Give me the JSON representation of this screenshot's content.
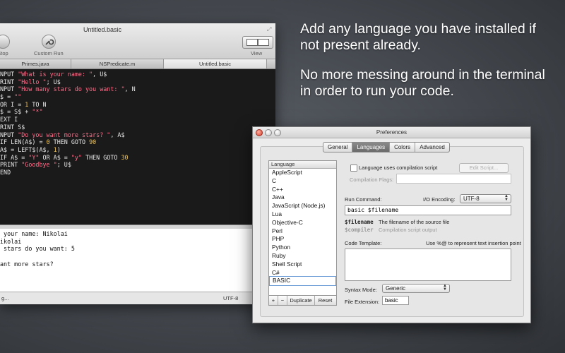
{
  "editor": {
    "title": "Untitled.basic",
    "toolbar": {
      "stop_label": "Stop",
      "custom_run_label": "Custom Run",
      "view_label": "View"
    },
    "tabs": [
      {
        "label": "Primes.java"
      },
      {
        "label": "NSPredicate.m"
      },
      {
        "label": "Untitled.basic"
      }
    ],
    "code_lines": [
      [
        {
          "t": "NPUT ",
          "c": "kw"
        },
        {
          "t": "\"What is your name: \"",
          "c": "str"
        },
        {
          "t": ", U$",
          "c": "var"
        }
      ],
      [
        {
          "t": "RINT ",
          "c": "kw"
        },
        {
          "t": "\"Hello \"",
          "c": "str"
        },
        {
          "t": "; U$",
          "c": "var"
        }
      ],
      [
        {
          "t": "NPUT ",
          "c": "kw"
        },
        {
          "t": "\"How many stars do you want: \"",
          "c": "str"
        },
        {
          "t": ", N",
          "c": "var"
        }
      ],
      [
        {
          "t": "$ = ",
          "c": "var"
        },
        {
          "t": "\"\"",
          "c": "str"
        }
      ],
      [
        {
          "t": "OR I = ",
          "c": "kw"
        },
        {
          "t": "1",
          "c": "num"
        },
        {
          "t": " TO N",
          "c": "kw"
        }
      ],
      [
        {
          "t": "$ = S$ + ",
          "c": "var"
        },
        {
          "t": "\"*\"",
          "c": "str"
        }
      ],
      [
        {
          "t": "EXT I",
          "c": "kw"
        }
      ],
      [
        {
          "t": "RINT S$",
          "c": "kw"
        }
      ],
      [
        {
          "t": "NPUT ",
          "c": "kw"
        },
        {
          "t": "\"Do you want more stars? \"",
          "c": "str"
        },
        {
          "t": ", A$",
          "c": "var"
        }
      ],
      [
        {
          "t": "IF LEN(A$) = ",
          "c": "kw"
        },
        {
          "t": "0",
          "c": "num"
        },
        {
          "t": " THEN GOTO ",
          "c": "kw"
        },
        {
          "t": "90",
          "c": "num"
        }
      ],
      [
        {
          "t": "A$ = LEFT$(A$, ",
          "c": "var"
        },
        {
          "t": "1",
          "c": "num"
        },
        {
          "t": ")",
          "c": "var"
        }
      ],
      [
        {
          "t": "IF A$ = ",
          "c": "kw"
        },
        {
          "t": "\"Y\"",
          "c": "str"
        },
        {
          "t": " OR A$ = ",
          "c": "kw"
        },
        {
          "t": "\"y\"",
          "c": "str"
        },
        {
          "t": " THEN GOTO ",
          "c": "kw"
        },
        {
          "t": "30",
          "c": "num"
        }
      ],
      [
        {
          "t": "PRINT ",
          "c": "kw"
        },
        {
          "t": "\"Goodbye \"",
          "c": "str"
        },
        {
          "t": "; U$",
          "c": "var"
        }
      ],
      [
        {
          "t": "END",
          "c": "kw"
        }
      ]
    ],
    "console_lines": [
      " your name: Nikolai",
      "ikolai",
      " stars do you want: 5",
      "",
      "ant more stars?"
    ],
    "status_left": "g...",
    "encoding": "UTF-8"
  },
  "headline": {
    "line1": "Add any language you have installed if not present already.",
    "line2": "No more messing around in the terminal in order to run your code."
  },
  "prefs": {
    "title": "Preferences",
    "tabs": [
      {
        "label": "General",
        "selected": false
      },
      {
        "label": "Languages",
        "selected": true
      },
      {
        "label": "Colors",
        "selected": false
      },
      {
        "label": "Advanced",
        "selected": false
      }
    ],
    "language_header": "Language",
    "languages": [
      "AppleScript",
      "C",
      "C++",
      "Java",
      "JavaScript (Node.js)",
      "Lua",
      "Objective-C",
      "Perl",
      "PHP",
      "Python",
      "Ruby",
      "Shell Script",
      "C#",
      "BASIC"
    ],
    "selected_language": "BASIC",
    "list_buttons": {
      "add": "+",
      "remove": "−",
      "duplicate": "Duplicate",
      "reset": "Reset"
    },
    "uses_compilation_label": "Language uses compilation script",
    "edit_script_label": "Edit Script...",
    "compilation_flags_label": "Compilation Flags:",
    "run_command_label": "Run Command:",
    "io_encoding_label": "I/O Encoding:",
    "io_encoding_value": "UTF-8",
    "run_command_value": "basic $filename",
    "filename_var": "$filename",
    "filename_desc": "The filename of the source file",
    "compiler_var": "$compiler",
    "compiler_desc": "Compilation script output",
    "code_template_label": "Code Template:",
    "code_template_hint": "Use %@ to represent text insertion point",
    "syntax_mode_label": "Syntax Mode:",
    "syntax_mode_value": "Generic",
    "file_extension_label": "File Extension:",
    "file_extension_value": "basic"
  },
  "colors": {
    "code_bg": "#1a1a1a",
    "string": "#ff6e8a",
    "number": "#f0c45a",
    "selection": "#6b9bd6"
  }
}
